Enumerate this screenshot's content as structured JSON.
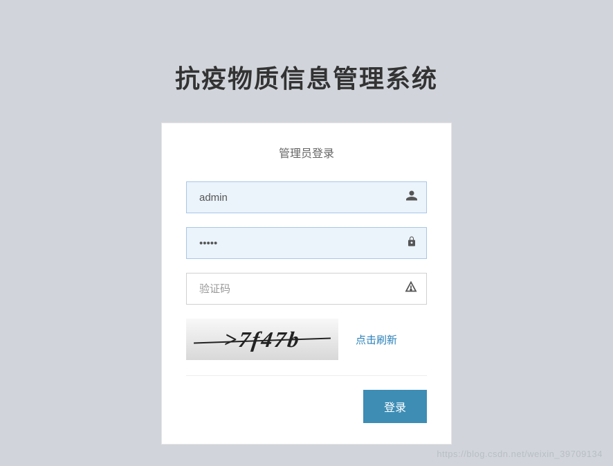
{
  "system": {
    "title": "抗疫物质信息管理系统"
  },
  "login": {
    "panel_title": "管理员登录",
    "username": {
      "value": "admin",
      "placeholder": ""
    },
    "password": {
      "value": "•••••",
      "placeholder": ""
    },
    "captcha": {
      "value": "",
      "placeholder": "验证码",
      "image_text": ">7f47b",
      "refresh_label": "点击刷新"
    },
    "submit_label": "登录"
  },
  "watermark": "https://blog.csdn.net/weixin_39709134"
}
